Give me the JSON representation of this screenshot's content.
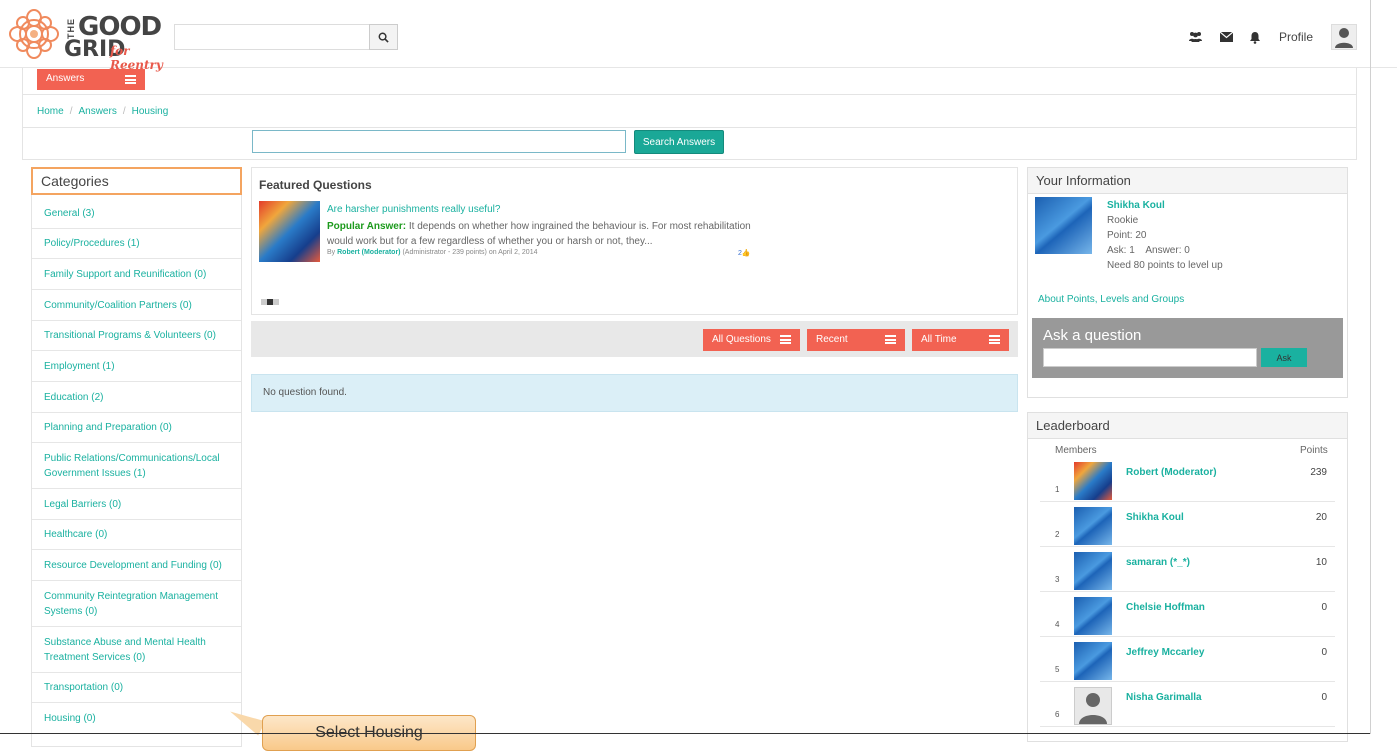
{
  "header": {
    "logo_the": "THE",
    "logo_good": "GOOD",
    "logo_grid": "GRID",
    "logo_reentry": "for Reentry",
    "search_placeholder": "",
    "profile_label": "Profile",
    "icons": [
      "search-icon",
      "users-icon",
      "envelope-icon",
      "bell-icon",
      "user-avatar-icon"
    ]
  },
  "subnav": {
    "answers_label": "Answers"
  },
  "breadcrumb": {
    "items": [
      "Home",
      "Answers",
      "Housing"
    ]
  },
  "answer_search": {
    "value": "",
    "button_label": "Search Answers"
  },
  "categories": {
    "title": "Categories",
    "items": [
      "General (3)",
      "Policy/Procedures (1)",
      "Family Support and Reunification (0)",
      "Community/Coalition Partners (0)",
      "Transitional Programs & Volunteers (0)",
      "Employment (1)",
      "Education (2)",
      "Planning and Preparation (0)",
      "Public Relations/Communications/Local Government Issues (1)",
      "Legal Barriers (0)",
      "Healthcare (0)",
      "Resource Development and Funding (0)",
      "Community Reintegration Management Systems (0)",
      "Substance Abuse and Mental Health Treatment Services (0)",
      "Transportation (0)",
      "Housing (0)"
    ]
  },
  "featured": {
    "title": "Featured Questions",
    "question": "Are harsher punishments really useful?",
    "answer_label": "Popular Answer:",
    "answer_text": "It depends on whether how ingrained the behaviour is. For most rehabilitation would work but for a few regardless of whether you or harsh or not, they...",
    "by_prefix": "By",
    "by_author": "Robert (Moderator)",
    "by_meta": "(Administrator - 239 points)  on April 2, 2014",
    "likes": "2"
  },
  "filters": {
    "all_questions": "All Questions",
    "recent": "Recent",
    "all_time": "All Time"
  },
  "no_question": "No question found.",
  "your_info": {
    "title": "Your Information",
    "name": "Shikha Koul",
    "rank": "Rookie",
    "points": "Point: 20",
    "ask_answer": "Ask: 1    Answer: 0",
    "level_note": "Need 80 points to level up",
    "about_link": "About Points, Levels and Groups",
    "ask_title": "Ask a question",
    "ask_button": "Ask"
  },
  "leaderboard": {
    "title": "Leaderboard",
    "col_members": "Members",
    "col_points": "Points",
    "rows": [
      {
        "rank": "1",
        "name": "Robert (Moderator)",
        "points": "239"
      },
      {
        "rank": "2",
        "name": "Shikha Koul",
        "points": "20"
      },
      {
        "rank": "3",
        "name": "samaran (*_*)",
        "points": "10"
      },
      {
        "rank": "4",
        "name": "Chelsie Hoffman",
        "points": "0"
      },
      {
        "rank": "5",
        "name": "Jeffrey Mccarley",
        "points": "0"
      },
      {
        "rank": "6",
        "name": "Nisha Garimalla",
        "points": "0"
      }
    ]
  },
  "callout": "Select Housing",
  "colors": {
    "accent": "#f26252",
    "teal": "#1ab1a0",
    "highlight": "#f4a460"
  }
}
